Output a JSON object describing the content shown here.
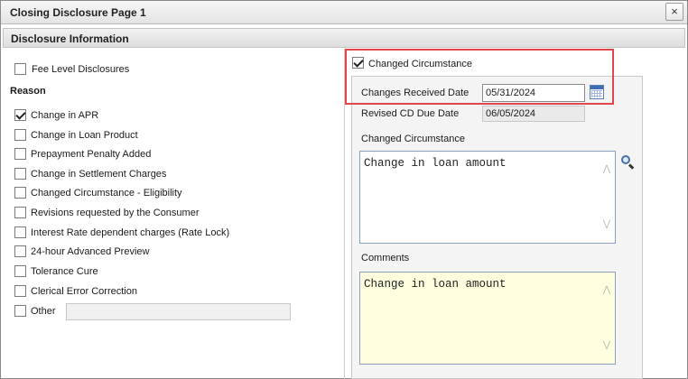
{
  "window": {
    "title": "Closing Disclosure Page 1",
    "close_label": "×"
  },
  "section": {
    "title": "Disclosure Information"
  },
  "left": {
    "fee_level": {
      "label": "Fee Level Disclosures",
      "checked": false
    },
    "reason_title": "Reason",
    "reasons": [
      {
        "label": "Change in APR",
        "checked": true
      },
      {
        "label": "Change in Loan Product",
        "checked": false
      },
      {
        "label": "Prepayment Penalty Added",
        "checked": false
      },
      {
        "label": "Change in Settlement Charges",
        "checked": false
      },
      {
        "label": "Changed Circumstance - Eligibility",
        "checked": false
      },
      {
        "label": "Revisions requested by the Consumer",
        "checked": false
      },
      {
        "label": "Interest Rate dependent charges (Rate Lock)",
        "checked": false
      },
      {
        "label": "24-hour Advanced Preview",
        "checked": false
      },
      {
        "label": "Tolerance Cure",
        "checked": false
      },
      {
        "label": "Clerical Error Correction",
        "checked": false
      },
      {
        "label": "Other",
        "checked": false
      }
    ],
    "other_value": ""
  },
  "right": {
    "changed_circumstance_checkbox": {
      "label": "Changed Circumstance",
      "checked": true
    },
    "changes_received_date": {
      "label": "Changes Received Date",
      "value": "05/31/2024"
    },
    "revised_cd_due_date": {
      "label": "Revised CD Due Date",
      "value": "06/05/2024"
    },
    "changed_circumstance_text": {
      "label": "Changed Circumstance",
      "value": "Change in loan amount"
    },
    "comments": {
      "label": "Comments",
      "value": "Change in loan amount"
    }
  },
  "colors": {
    "highlight": "#e0464a",
    "comments_bg": "#fefede",
    "calendar_accent": "#3d6db5"
  },
  "icons": [
    "calendar-icon",
    "search-icon",
    "scroll-up-icon",
    "scroll-down-icon",
    "close-icon"
  ]
}
